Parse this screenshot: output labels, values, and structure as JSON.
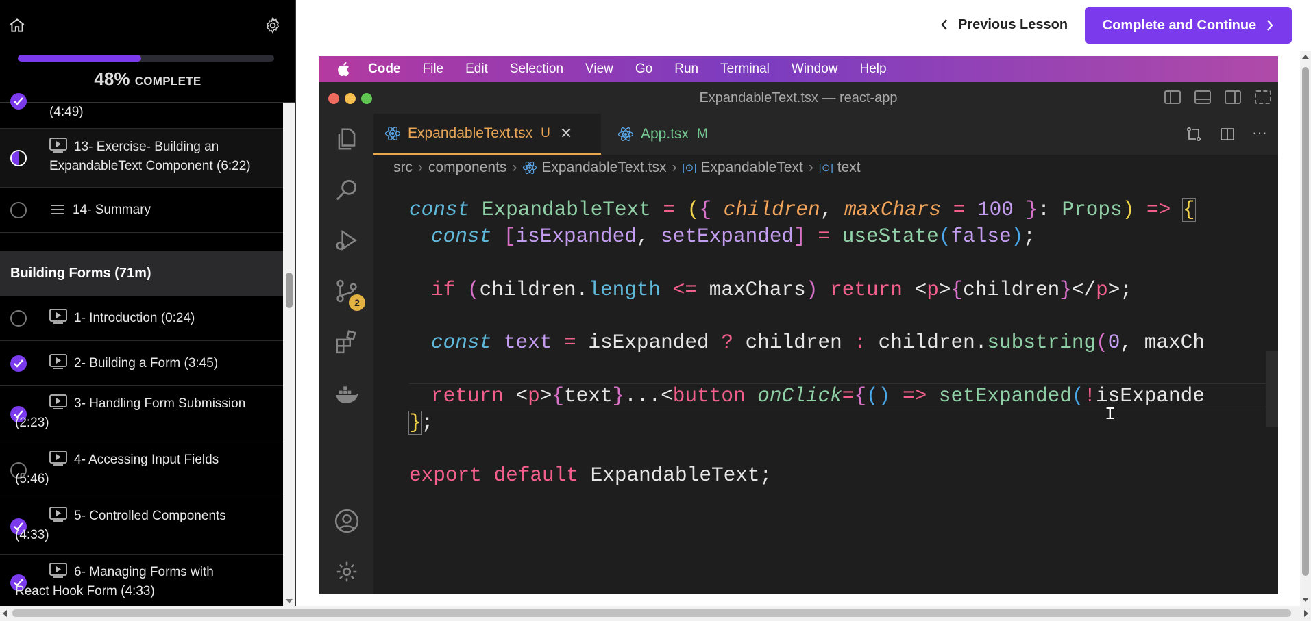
{
  "sidebar": {
    "progress_fraction": 0.48,
    "progress_percent": "48%",
    "progress_suffix": "COMPLETE",
    "lessons_top": [
      {
        "label": "(4:49)",
        "status": "done"
      },
      {
        "label": "13- Exercise- Building an ExpandableText Component (6:22)",
        "status": "in-progress",
        "icon": "video-icon"
      },
      {
        "label": "14- Summary",
        "status": "empty",
        "icon": "text-icon"
      }
    ],
    "section_title": "Building Forms (71m)",
    "lessons": [
      {
        "label": "1- Introduction (0:24)",
        "status": "empty",
        "icon": "video-icon"
      },
      {
        "label": "2- Building a Form (3:45)",
        "status": "done",
        "icon": "video-icon"
      },
      {
        "label": "3- Handling Form Submission",
        "label2": "(2:23)",
        "status": "done",
        "icon": "video-icon"
      },
      {
        "label": "4- Accessing Input Fields",
        "label2": "(5:46)",
        "status": "empty",
        "icon": "video-icon"
      },
      {
        "label": "5- Controlled Components",
        "label2": "(4:33)",
        "status": "done",
        "icon": "video-icon"
      },
      {
        "label": "6- Managing Forms with",
        "label2": "React Hook Form (4:33)",
        "status": "done",
        "icon": "video-icon"
      }
    ]
  },
  "header": {
    "prev_label": "Previous Lesson",
    "next_label": "Complete and Continue"
  },
  "mac_menu": {
    "app": "Code",
    "items": [
      "File",
      "Edit",
      "Selection",
      "View",
      "Go",
      "Run",
      "Terminal",
      "Window",
      "Help"
    ]
  },
  "vscode": {
    "window_title": "ExpandableText.tsx — react-app",
    "badge_count": "2",
    "tabs": [
      {
        "name": "ExpandableText.tsx",
        "state": "U",
        "active": true
      },
      {
        "name": "App.tsx",
        "state": "M",
        "active": false
      }
    ],
    "breadcrumb": [
      "src",
      "components",
      "ExpandableText.tsx",
      "ExpandableText",
      "text"
    ],
    "colors": {
      "accent": "#7c3aed",
      "tab_active": "#e9a555",
      "modified": "#74c991"
    }
  }
}
